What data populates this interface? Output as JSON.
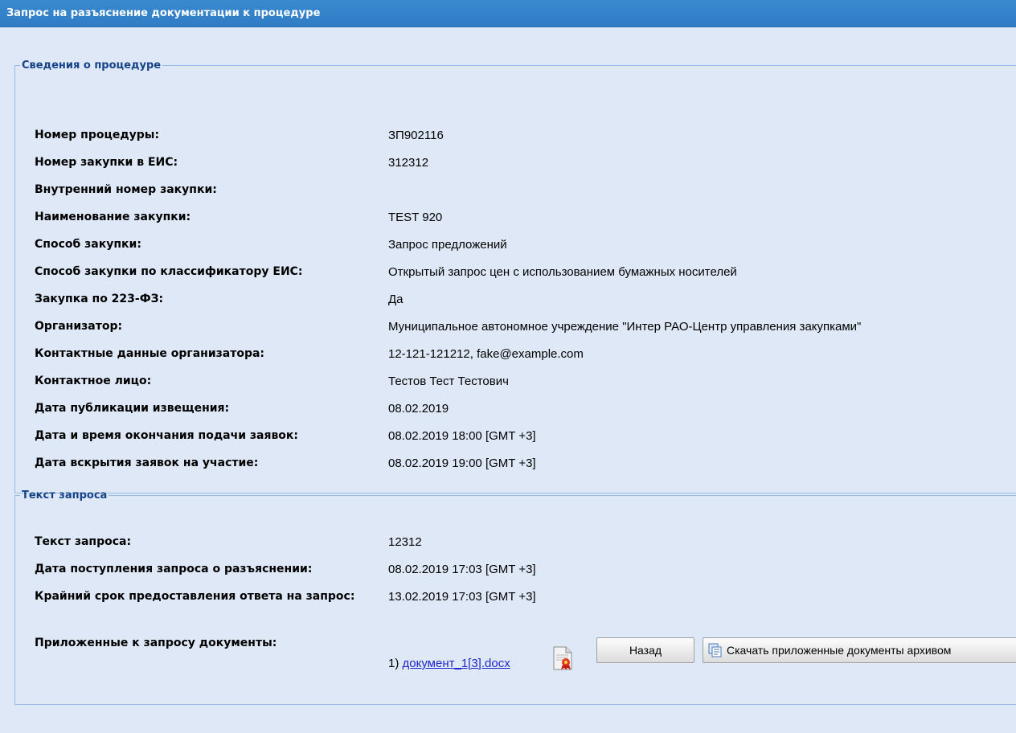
{
  "window": {
    "title": "Запрос на разъяснение документации к процедуре"
  },
  "procedure": {
    "legend": "Сведения о процедуре",
    "rows": [
      {
        "label": "Номер процедуры:",
        "value": "ЗП902116"
      },
      {
        "label": "Номер закупки в ЕИС:",
        "value": "312312"
      },
      {
        "label": "Внутренний номер закупки:",
        "value": ""
      },
      {
        "label": "Наименование закупки:",
        "value": "TEST 920"
      },
      {
        "label": "Способ закупки:",
        "value": "Запрос предложений"
      },
      {
        "label": "Способ закупки по классификатору ЕИС:",
        "value": "Открытый запрос цен с использованием бумажных носителей"
      },
      {
        "label": "Закупка по 223-ФЗ:",
        "value": "Да"
      },
      {
        "label": "Организатор:",
        "value": "Муниципальное автономное учреждение \"Интер РАО-Центр управления закупками\""
      },
      {
        "label": "Контактные данные организатора:",
        "value": "12-121-121212, fake@example.com"
      },
      {
        "label": "Контактное лицо:",
        "value": "Тестов Тест Тестович"
      },
      {
        "label": "Дата публикации извещения:",
        "value": "08.02.2019"
      },
      {
        "label": "Дата и время окончания подачи заявок:",
        "value": "08.02.2019 18:00 [GMT +3]"
      },
      {
        "label": "Дата вскрытия заявок на участие:",
        "value": "08.02.2019 19:00 [GMT +3]"
      }
    ]
  },
  "request": {
    "legend": "Текст запроса",
    "rows": [
      {
        "label": "Текст запроса:",
        "value": "12312"
      },
      {
        "label": "Дата поступления запроса о разъяснении:",
        "value": "08.02.2019 17:03 [GMT +3]"
      },
      {
        "label": "Крайний срок предоставления ответа на запрос:",
        "value": "13.02.2019 17:03 [GMT +3]"
      },
      {
        "label": "Приложенные к запросу документы:",
        "value": ""
      }
    ],
    "attachments": [
      {
        "index": "1)",
        "name": "документ_1[3].docx",
        "icon": "signed-document-icon"
      }
    ]
  },
  "buttons": {
    "back_label": "Назад",
    "download_label": "Скачать приложенные документы архивом",
    "download_icon": "archive-copy-icon"
  }
}
